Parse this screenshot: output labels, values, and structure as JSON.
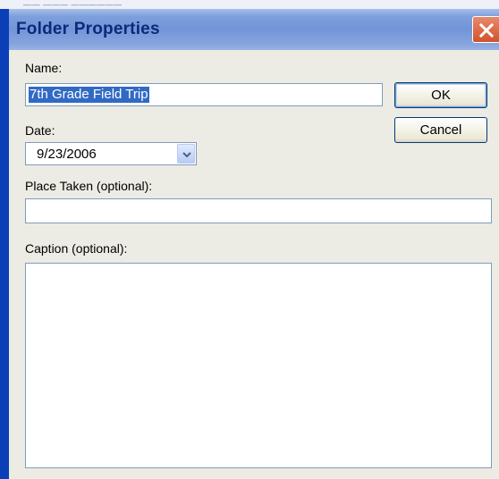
{
  "window": {
    "title": "Folder Properties",
    "background_text": "—— ——— ——————"
  },
  "form": {
    "name_label": "Name:",
    "name_value": "7th Grade Field Trip",
    "date_label": "Date:",
    "date_value": "9/23/2006",
    "place_label": "Place Taken (optional):",
    "place_value": "",
    "caption_label": "Caption (optional):",
    "caption_value": ""
  },
  "buttons": {
    "ok_label": "OK",
    "cancel_label": "Cancel"
  },
  "icons": {
    "close": "close-icon",
    "dropdown": "chevron-down-icon"
  },
  "colors": {
    "titlebar": "#7395d8",
    "title_text": "#0b2a7a",
    "close_button": "#d0532c",
    "client_background": "#ecebe4",
    "selection": "#316ac5",
    "input_border": "#7f9db9"
  }
}
